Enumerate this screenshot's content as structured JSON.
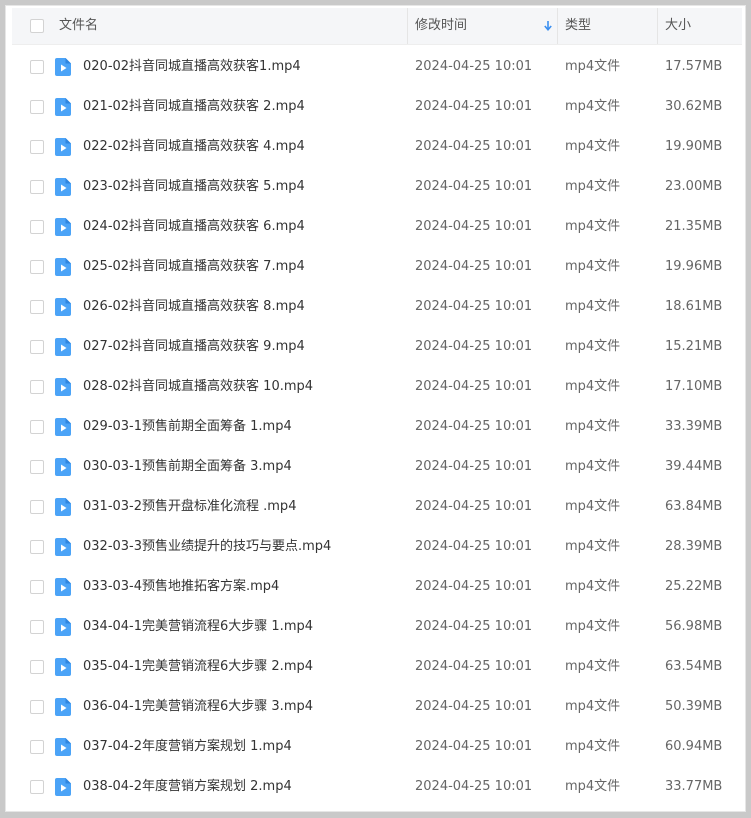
{
  "header": {
    "name": "文件名",
    "time": "修改时间",
    "type": "类型",
    "size": "大小"
  },
  "colors": {
    "accent": "#3b8ff0",
    "file_icon": "#4ba3f7"
  },
  "sort_icon": "arrow-down-icon",
  "files": [
    {
      "name": "020-02抖音同城直播高效获客1.mp4",
      "time": "2024-04-25 10:01",
      "type": "mp4文件",
      "size": "17.57MB"
    },
    {
      "name": "021-02抖音同城直播高效获客 2.mp4",
      "time": "2024-04-25 10:01",
      "type": "mp4文件",
      "size": "30.62MB"
    },
    {
      "name": "022-02抖音同城直播高效获客 4.mp4",
      "time": "2024-04-25 10:01",
      "type": "mp4文件",
      "size": "19.90MB"
    },
    {
      "name": "023-02抖音同城直播高效获客 5.mp4",
      "time": "2024-04-25 10:01",
      "type": "mp4文件",
      "size": "23.00MB"
    },
    {
      "name": "024-02抖音同城直播高效获客 6.mp4",
      "time": "2024-04-25 10:01",
      "type": "mp4文件",
      "size": "21.35MB"
    },
    {
      "name": "025-02抖音同城直播高效获客 7.mp4",
      "time": "2024-04-25 10:01",
      "type": "mp4文件",
      "size": "19.96MB"
    },
    {
      "name": "026-02抖音同城直播高效获客 8.mp4",
      "time": "2024-04-25 10:01",
      "type": "mp4文件",
      "size": "18.61MB"
    },
    {
      "name": "027-02抖音同城直播高效获客 9.mp4",
      "time": "2024-04-25 10:01",
      "type": "mp4文件",
      "size": "15.21MB"
    },
    {
      "name": "028-02抖音同城直播高效获客 10.mp4",
      "time": "2024-04-25 10:01",
      "type": "mp4文件",
      "size": "17.10MB"
    },
    {
      "name": "029-03-1预售前期全面筹备 1.mp4",
      "time": "2024-04-25 10:01",
      "type": "mp4文件",
      "size": "33.39MB"
    },
    {
      "name": "030-03-1预售前期全面筹备 3.mp4",
      "time": "2024-04-25 10:01",
      "type": "mp4文件",
      "size": "39.44MB"
    },
    {
      "name": "031-03-2预售开盘标准化流程 .mp4",
      "time": "2024-04-25 10:01",
      "type": "mp4文件",
      "size": "63.84MB"
    },
    {
      "name": "032-03-3预售业绩提升的技巧与要点.mp4",
      "time": "2024-04-25 10:01",
      "type": "mp4文件",
      "size": "28.39MB"
    },
    {
      "name": "033-03-4预售地推拓客方案.mp4",
      "time": "2024-04-25 10:01",
      "type": "mp4文件",
      "size": "25.22MB"
    },
    {
      "name": "034-04-1完美营销流程6大步骤 1.mp4",
      "time": "2024-04-25 10:01",
      "type": "mp4文件",
      "size": "56.98MB"
    },
    {
      "name": "035-04-1完美营销流程6大步骤 2.mp4",
      "time": "2024-04-25 10:01",
      "type": "mp4文件",
      "size": "63.54MB"
    },
    {
      "name": "036-04-1完美营销流程6大步骤 3.mp4",
      "time": "2024-04-25 10:01",
      "type": "mp4文件",
      "size": "50.39MB"
    },
    {
      "name": "037-04-2年度营销方案规划 1.mp4",
      "time": "2024-04-25 10:01",
      "type": "mp4文件",
      "size": "60.94MB"
    },
    {
      "name": "038-04-2年度营销方案规划 2.mp4",
      "time": "2024-04-25 10:01",
      "type": "mp4文件",
      "size": "33.77MB"
    }
  ]
}
